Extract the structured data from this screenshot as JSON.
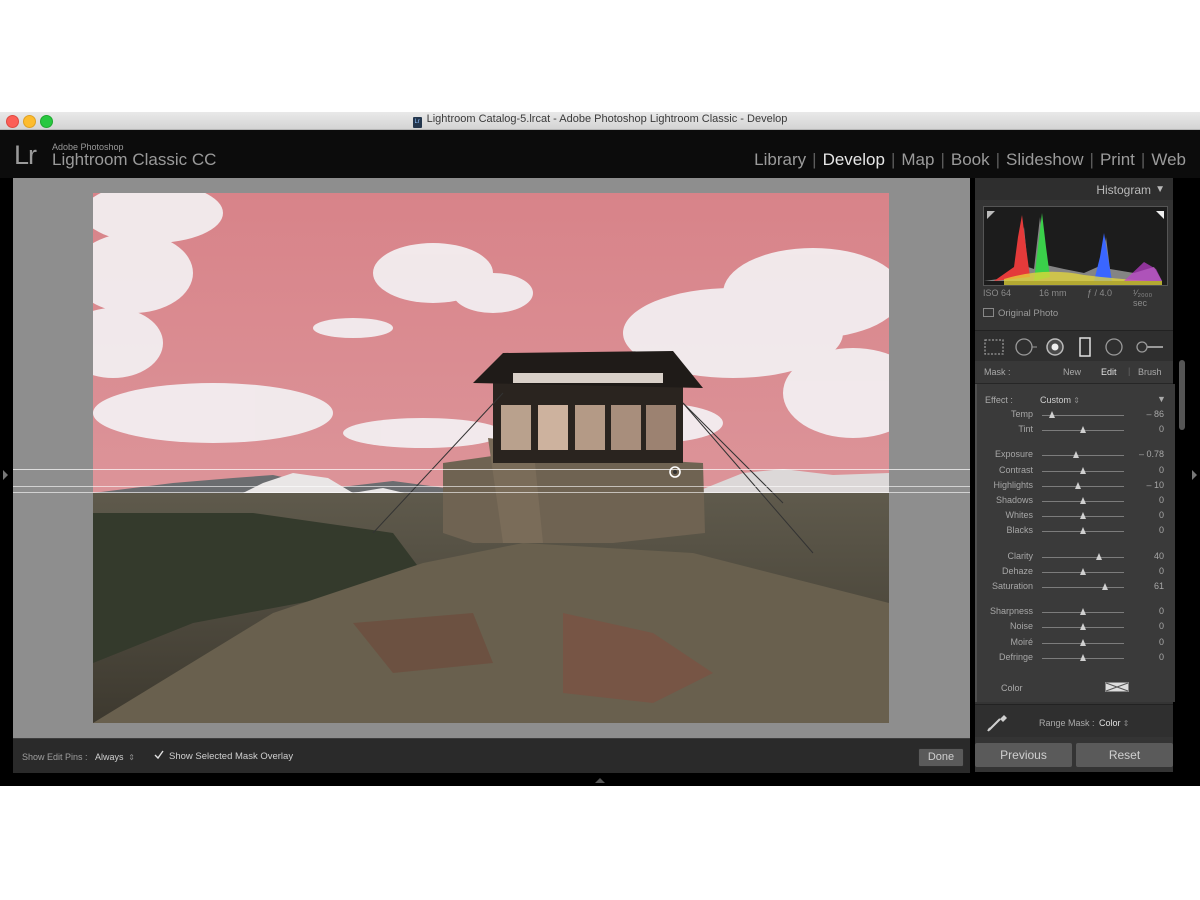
{
  "window": {
    "title": "Lightroom Catalog-5.lrcat - Adobe Photoshop Lightroom Classic - Develop",
    "doc_icon": "Lr"
  },
  "brand": {
    "logo": "Lr",
    "line1": "Adobe Photoshop",
    "line2": "Lightroom Classic CC"
  },
  "modules": [
    {
      "label": "Library",
      "active": false
    },
    {
      "label": "Develop",
      "active": true
    },
    {
      "label": "Map",
      "active": false
    },
    {
      "label": "Book",
      "active": false
    },
    {
      "label": "Slideshow",
      "active": false
    },
    {
      "label": "Print",
      "active": false
    },
    {
      "label": "Web",
      "active": false
    }
  ],
  "toolbar": {
    "show_edit_pins_label": "Show Edit Pins :",
    "show_edit_pins_value": "Always",
    "show_mask_overlay_label": "Show Selected Mask Overlay",
    "show_mask_overlay_checked": true,
    "done_label": "Done"
  },
  "histogram": {
    "title": "Histogram",
    "iso": "ISO 64",
    "focal": "16 mm",
    "aperture": "ƒ / 4.0",
    "shutter": "¹⁄₂₀₀₀ sec",
    "original_photo_label": "Original Photo"
  },
  "mask": {
    "label": "Mask :",
    "new": "New",
    "edit": "Edit",
    "brush": "Brush"
  },
  "effect": {
    "label": "Effect :",
    "value": "Custom"
  },
  "sliders": [
    {
      "label": "Temp",
      "value": "– 86",
      "pos": 0.13,
      "group": 0
    },
    {
      "label": "Tint",
      "value": "0",
      "pos": 0.5,
      "group": 0
    },
    {
      "label": "Exposure",
      "value": "– 0.78",
      "pos": 0.42,
      "group": 1
    },
    {
      "label": "Contrast",
      "value": "0",
      "pos": 0.5,
      "group": 1
    },
    {
      "label": "Highlights",
      "value": "– 10",
      "pos": 0.45,
      "group": 1
    },
    {
      "label": "Shadows",
      "value": "0",
      "pos": 0.5,
      "group": 1
    },
    {
      "label": "Whites",
      "value": "0",
      "pos": 0.5,
      "group": 1
    },
    {
      "label": "Blacks",
      "value": "0",
      "pos": 0.5,
      "group": 1
    },
    {
      "label": "Clarity",
      "value": "40",
      "pos": 0.7,
      "group": 2
    },
    {
      "label": "Dehaze",
      "value": "0",
      "pos": 0.5,
      "group": 2
    },
    {
      "label": "Saturation",
      "value": "61",
      "pos": 0.78,
      "group": 2
    },
    {
      "label": "Sharpness",
      "value": "0",
      "pos": 0.5,
      "group": 3
    },
    {
      "label": "Noise",
      "value": "0",
      "pos": 0.5,
      "group": 3
    },
    {
      "label": "Moiré",
      "value": "0",
      "pos": 0.5,
      "group": 3
    },
    {
      "label": "Defringe",
      "value": "0",
      "pos": 0.5,
      "group": 3
    }
  ],
  "color_label": "Color",
  "range_mask": {
    "label": "Range Mask :",
    "value": "Color"
  },
  "buttons": {
    "previous": "Previous",
    "reset": "Reset"
  },
  "colors": {
    "mask_overlay": "#d98a8e",
    "active_module": "#e6e6e6",
    "panel_bg": "#3a3a3a"
  }
}
